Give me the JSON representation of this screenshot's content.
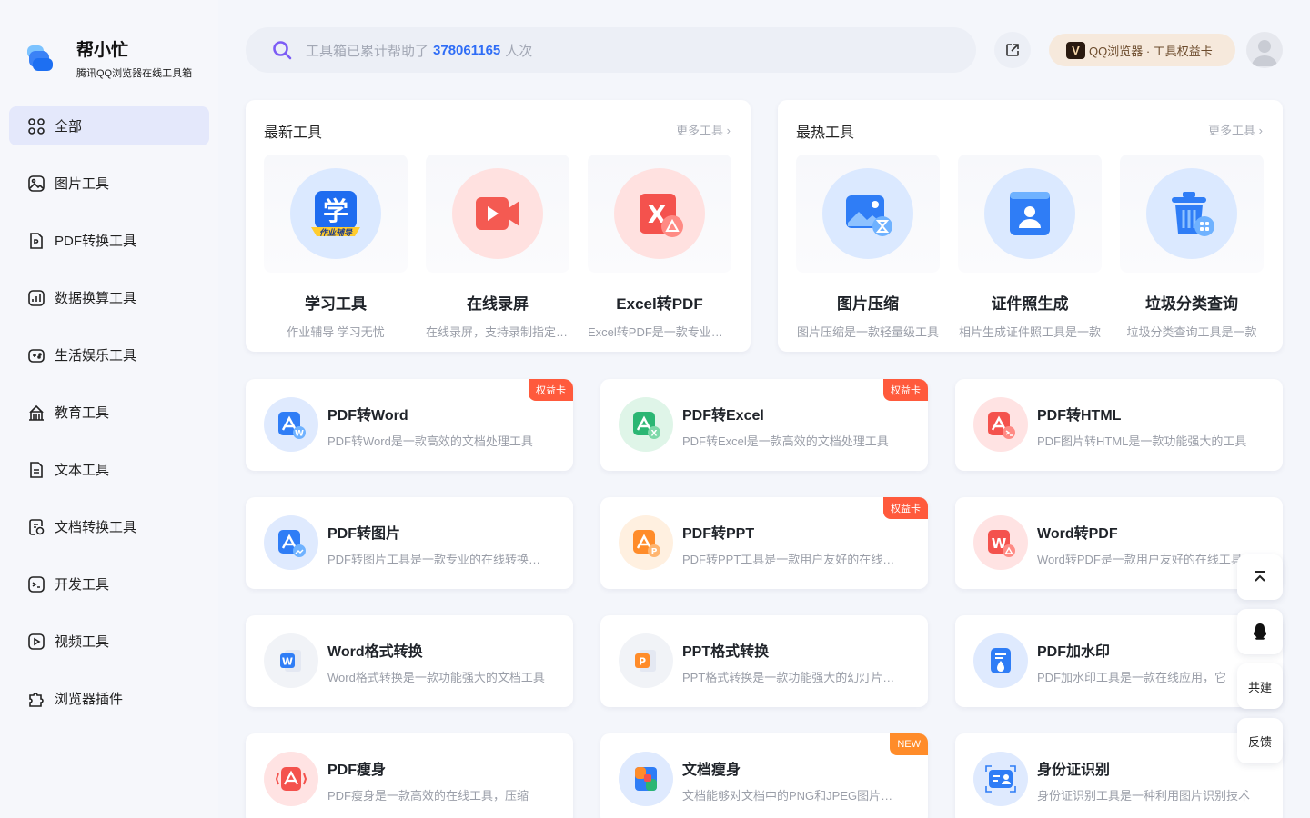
{
  "brand": {
    "title": "帮小忙",
    "subtitle": "腾讯QQ浏览器在线工具箱"
  },
  "nav": [
    {
      "label": "全部",
      "icon": "grid-icon",
      "active": true
    },
    {
      "label": "图片工具",
      "icon": "image-icon"
    },
    {
      "label": "PDF转换工具",
      "icon": "pdf-icon"
    },
    {
      "label": "数据换算工具",
      "icon": "chart-icon"
    },
    {
      "label": "生活娱乐工具",
      "icon": "gamepad-icon"
    },
    {
      "label": "教育工具",
      "icon": "school-icon"
    },
    {
      "label": "文本工具",
      "icon": "text-icon"
    },
    {
      "label": "文档转换工具",
      "icon": "document-convert-icon"
    },
    {
      "label": "开发工具",
      "icon": "code-icon"
    },
    {
      "label": "视频工具",
      "icon": "video-icon"
    },
    {
      "label": "浏览器插件",
      "icon": "puzzle-icon"
    }
  ],
  "search": {
    "prefix": "工具箱已累计帮助了",
    "count": "378061165",
    "suffix": "人次"
  },
  "header": {
    "vip_label": "QQ浏览器 · 工具权益卡",
    "vip_badge": "V"
  },
  "latest": {
    "title": "最新工具",
    "more": "更多工具",
    "tools": [
      {
        "name": "学习工具",
        "desc": "作业辅导 学习无忧"
      },
      {
        "name": "在线录屏",
        "desc": "在线录屏，支持录制指定区域"
      },
      {
        "name": "Excel转PDF",
        "desc": "Excel转PDF是一款专业工具"
      }
    ]
  },
  "hot": {
    "title": "最热工具",
    "more": "更多工具",
    "tools": [
      {
        "name": "图片压缩",
        "desc": "图片压缩是一款轻量级工具"
      },
      {
        "name": "证件照生成",
        "desc": "相片生成证件照工具是一款"
      },
      {
        "name": "垃圾分类查询",
        "desc": "垃圾分类查询工具是一款"
      }
    ]
  },
  "cards": [
    {
      "name": "PDF转Word",
      "desc": "PDF转Word是一款高效的文档处理工具",
      "badge": "权益卡"
    },
    {
      "name": "PDF转Excel",
      "desc": "PDF转Excel是一款高效的文档处理工具",
      "badge": "权益卡"
    },
    {
      "name": "PDF转HTML",
      "desc": "PDF图片转HTML是一款功能强大的工具",
      "badge": ""
    },
    {
      "name": "PDF转图片",
      "desc": "PDF转图片工具是一款专业的在线转换工具",
      "badge": ""
    },
    {
      "name": "PDF转PPT",
      "desc": "PDF转PPT工具是一款用户友好的在线工具",
      "badge": "权益卡"
    },
    {
      "name": "Word转PDF",
      "desc": "Word转PDF是一款用户友好的在线工具",
      "badge": ""
    },
    {
      "name": "Word格式转换",
      "desc": "Word格式转换是一款功能强大的文档工具",
      "badge": ""
    },
    {
      "name": "PPT格式转换",
      "desc": "PPT格式转换是一款功能强大的幻灯片工具",
      "badge": ""
    },
    {
      "name": "PDF加水印",
      "desc": "PDF加水印工具是一款在线应用，它",
      "badge": ""
    },
    {
      "name": "PDF瘦身",
      "desc": "PDF瘦身是一款高效的在线工具，压缩",
      "badge": ""
    },
    {
      "name": "文档瘦身",
      "desc": "文档能够对文档中的PNG和JPEG图片进行压缩",
      "badge": "NEW"
    },
    {
      "name": "身份证识别",
      "desc": "身份证识别工具是一种利用图片识别技术",
      "badge": ""
    }
  ],
  "float": {
    "top_icon": "back-to-top-icon",
    "qq_icon": "qq-penguin-icon",
    "cobuild": "共建",
    "feedback": "反馈"
  }
}
